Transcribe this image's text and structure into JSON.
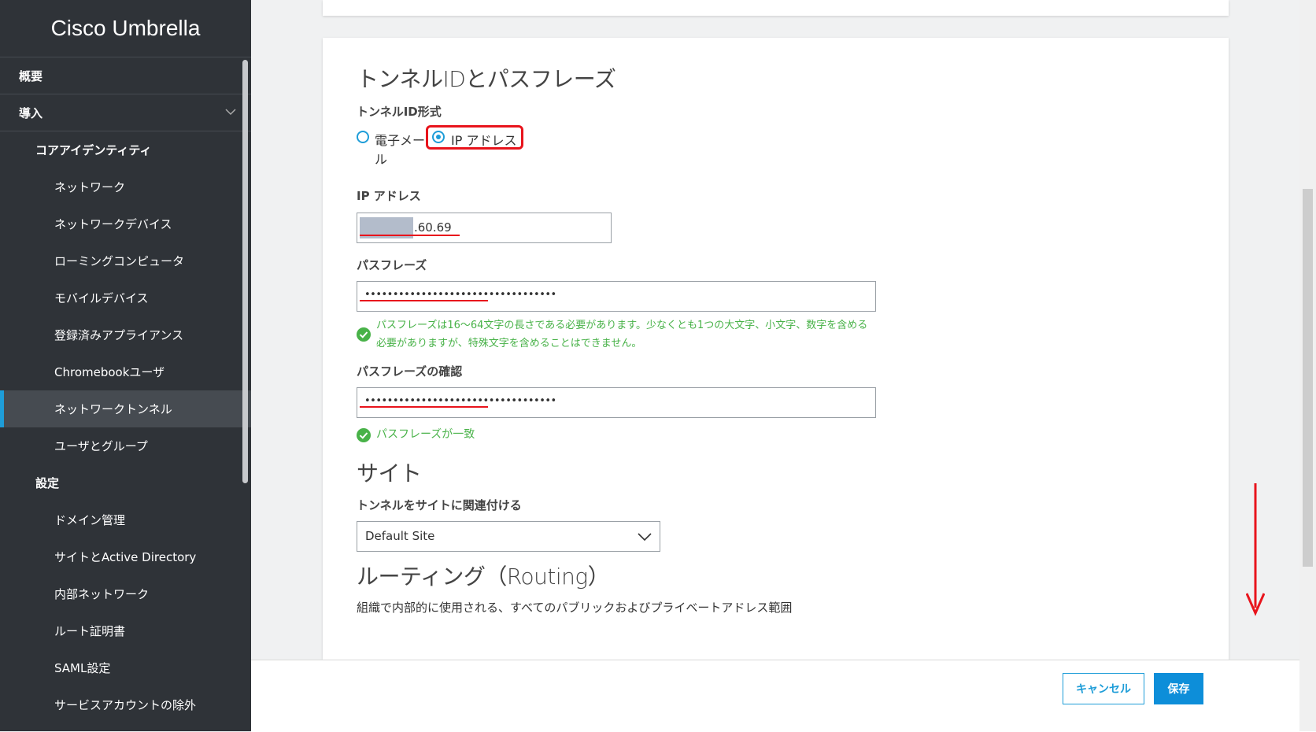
{
  "app": {
    "title": "Cisco Umbrella"
  },
  "sidebar": {
    "items": [
      {
        "label": "概要"
      },
      {
        "label": "導入"
      },
      {
        "label": "コアアイデンティティ"
      },
      {
        "label": "ネットワーク"
      },
      {
        "label": "ネットワークデバイス"
      },
      {
        "label": "ローミングコンピュータ"
      },
      {
        "label": "モバイルデバイス"
      },
      {
        "label": "登録済みアプライアンス"
      },
      {
        "label": "Chromebookユーザ"
      },
      {
        "label": "ネットワークトンネル"
      },
      {
        "label": "ユーザとグループ"
      },
      {
        "label": "設定"
      },
      {
        "label": "ドメイン管理"
      },
      {
        "label": "サイトとActive Directory"
      },
      {
        "label": "内部ネットワーク"
      },
      {
        "label": "ルート証明書"
      },
      {
        "label": "SAML設定"
      },
      {
        "label": "サービスアカウントの除外"
      }
    ]
  },
  "form": {
    "section_title": "トンネルIDとパスフレーズ",
    "tunnel_id_format_label": "トンネルID形式",
    "radio_email_line1": "電子メー",
    "radio_email_line2": "ル",
    "radio_ip": "IP アドレス",
    "ip_label": "IP アドレス",
    "ip_value": ".60.69",
    "passphrase_label": "パスフレーズ",
    "passphrase_value": "••••••••••••••••••••••••••••••••••",
    "passphrase_hint_line1": "パスフレーズは16～64文字の長さである必要があります。少なくとも1つの大文字、小文字、数字を含める",
    "passphrase_hint_line2": "必要がありますが、特殊文字を含めることはできません。",
    "confirm_label": "パスフレーズの確認",
    "confirm_value": "••••••••••••••••••••••••••••••••••",
    "confirm_hint": "パスフレーズが一致",
    "site_title": "サイト",
    "site_label": "トンネルをサイトに関連付ける",
    "site_value": "Default Site",
    "routing_title": "ルーティング（Routing）",
    "routing_desc": "組織で内部的に使用される、すべてのパブリックおよびプライベートアドレス範囲"
  },
  "footer": {
    "cancel": "キャンセル",
    "save": "保存"
  },
  "colors": {
    "accent": "#1e9dd8",
    "annotation": "#e8141c",
    "success": "#48b248",
    "sidebar": "#2f3338"
  }
}
